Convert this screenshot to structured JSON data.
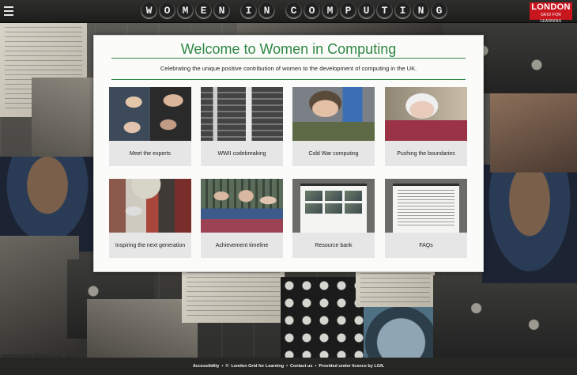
{
  "header": {
    "title_letters": [
      "W",
      "O",
      "M",
      "E",
      "N",
      " ",
      "I",
      "N",
      " ",
      "C",
      "O",
      "M",
      "P",
      "U",
      "T",
      "I",
      "N",
      "G"
    ],
    "logo": {
      "line1": "LONDON",
      "line2": "GRID FOR LEARNING"
    }
  },
  "main": {
    "heading": "Welcome to Women in Computing",
    "subtitle": "Celebrating the unique positive contribution of women to the development of computing in the UK.",
    "cards": [
      {
        "label": "Meet the experts",
        "image": "experts"
      },
      {
        "label": "WWII codebreaking",
        "image": "wwii"
      },
      {
        "label": "Cold War computing",
        "image": "coldwar"
      },
      {
        "label": "Pushing the boundaries",
        "image": "pushing"
      },
      {
        "label": "Inspiring the next generation",
        "image": "inspiring"
      },
      {
        "label": "Achievement timeline",
        "image": "timeline"
      },
      {
        "label": "Resource bank",
        "image": "resource"
      },
      {
        "label": "FAQs",
        "image": "faqs"
      }
    ]
  },
  "footer": {
    "accessibility": "Accessibility",
    "sep": "•",
    "copyright_symbol": "©",
    "copyright": "London Grid for Learning",
    "contact": "Contact us",
    "licence": "Provided under licence by LGfL"
  },
  "colors": {
    "accent_green": "#2e8743",
    "brand_red": "#c9151e"
  }
}
